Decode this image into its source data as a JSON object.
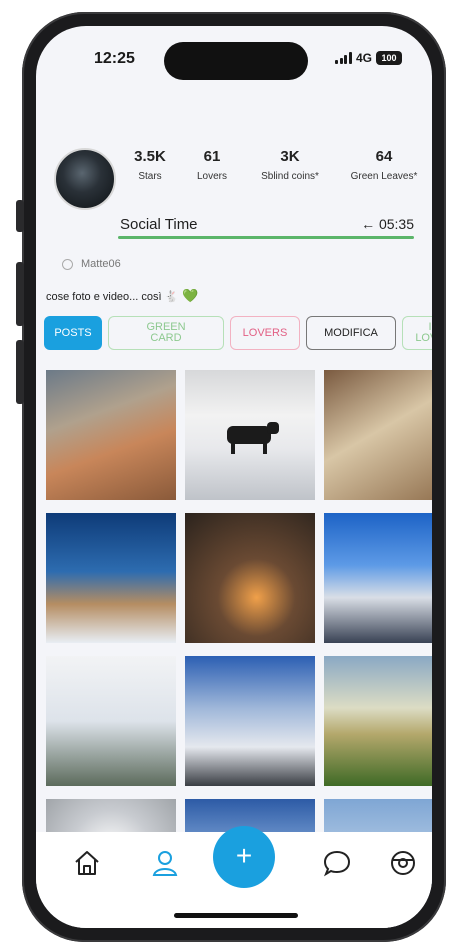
{
  "status_bar": {
    "time": "12:25",
    "network": "4G",
    "battery": "100"
  },
  "profile": {
    "stats": [
      {
        "value": "3.5K",
        "label": "Stars"
      },
      {
        "value": "61",
        "label": "Lovers"
      },
      {
        "value": "3K",
        "label": "Sblind coins*"
      },
      {
        "value": "64",
        "label": "Green Leaves*"
      }
    ],
    "social_time_label": "Social Time",
    "social_time_value": "← 05:35",
    "username": "Matte06",
    "bio": "cose foto e video... così 🐇",
    "bio_heart": "💚"
  },
  "tabs": [
    {
      "label": "POSTS"
    },
    {
      "label": "GREEN\nCARD"
    },
    {
      "label": "LOVERS"
    },
    {
      "label": "MODIFICA"
    },
    {
      "label": "I\nLOVE"
    }
  ],
  "nav": {
    "add_label": "+"
  },
  "colors": {
    "accent": "#1aa0df",
    "green": "#5bb56a",
    "pink": "#e25f84"
  }
}
